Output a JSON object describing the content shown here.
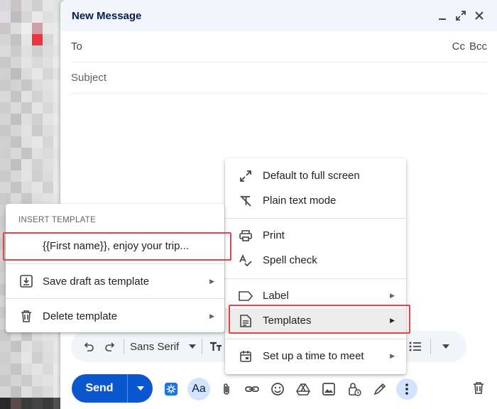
{
  "compose": {
    "title": "New Message",
    "to_label": "To",
    "cc_label": "Cc",
    "bcc_label": "Bcc",
    "subject_placeholder": "Subject"
  },
  "toolbar": {
    "font_family": "Sans Serif"
  },
  "send": {
    "label": "Send"
  },
  "bottom": {
    "format_label": "Aa"
  },
  "more_menu": {
    "items": [
      {
        "label": "Default to full screen",
        "icon": "expand-icon"
      },
      {
        "label": "Plain text mode",
        "icon": "plain-text-icon"
      },
      {
        "label": "Print",
        "icon": "print-icon"
      },
      {
        "label": "Spell check",
        "icon": "spell-check-icon"
      },
      {
        "label": "Label",
        "icon": "label-icon"
      },
      {
        "label": "Templates",
        "icon": "templates-icon"
      },
      {
        "label": "Set up a time to meet",
        "icon": "calendar-icon"
      }
    ]
  },
  "templates_menu": {
    "heading": "INSERT TEMPLATE",
    "template_name": "{{First name}}, enjoy your trip...",
    "save_label": "Save draft as template",
    "delete_label": "Delete template"
  },
  "colors": {
    "send_button": "#0b57d0",
    "header_bg": "#f2f6fc",
    "highlight_box": "#e0454b"
  }
}
